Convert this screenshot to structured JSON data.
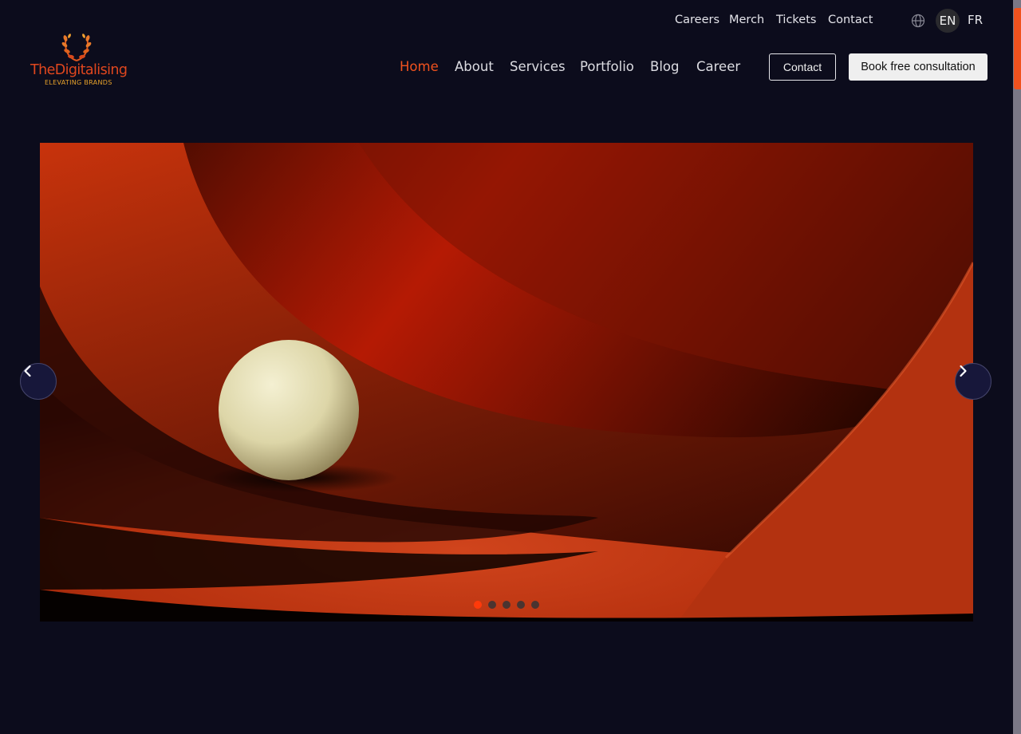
{
  "topbar": {
    "links": [
      "Careers",
      "Merch",
      "Tickets",
      "Contact"
    ],
    "languages": [
      "EN",
      "FR"
    ],
    "active_language": "EN",
    "globe_icon": "globe-icon"
  },
  "logo": {
    "name": "TheDigitalising",
    "tagline": "ELEVATING BRANDS",
    "icon": "laurel-wreath-icon"
  },
  "nav": {
    "items": [
      "Home",
      "About",
      "Services",
      "Portfolio",
      "Blog",
      "Career"
    ],
    "active": "Home",
    "contact_button": "Contact",
    "book_button": "Book free consultation"
  },
  "carousel": {
    "slide_count": 5,
    "active_slide": 1,
    "prev_icon": "chevron-left-icon",
    "next_icon": "chevron-right-icon"
  },
  "colors": {
    "background": "#0c0c1c",
    "accent": "#f0521e",
    "button_light": "#efefef"
  }
}
